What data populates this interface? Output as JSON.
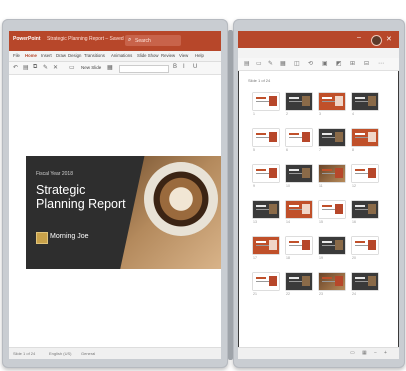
{
  "left": {
    "app_name": "PowerPoint",
    "document_title": "Strategic Planning Report – Saved",
    "search_placeholder": "Search",
    "menu": [
      "File",
      "Home",
      "Insert",
      "Draw",
      "Design",
      "Transitions",
      "Animations",
      "Slide Show",
      "Review",
      "View",
      "Help"
    ],
    "active_menu": "Home",
    "new_slide_label": "New Slide",
    "slide": {
      "subtitle": "Fiscal Year 2018",
      "title_line1": "Strategic",
      "title_line2": "Planning Report",
      "brand": "Morning Joe"
    },
    "status": {
      "slide_count": "Slide 1 of 24",
      "language": "English (US)",
      "general": "General"
    }
  },
  "right": {
    "sort_label": "Slide 1 of 24",
    "slide_numbers": [
      "1",
      "2",
      "3",
      "4",
      "5",
      "6",
      "7",
      "8",
      "9",
      "10",
      "11",
      "12",
      "13",
      "14",
      "15",
      "16",
      "17",
      "18",
      "19",
      "20",
      "21",
      "22",
      "23",
      "24"
    ],
    "zoom_label": "−"
  },
  "colors": {
    "accent": "#b7472a",
    "slide_dark": "#2e2e2e",
    "frame": "#c9cdd2"
  }
}
